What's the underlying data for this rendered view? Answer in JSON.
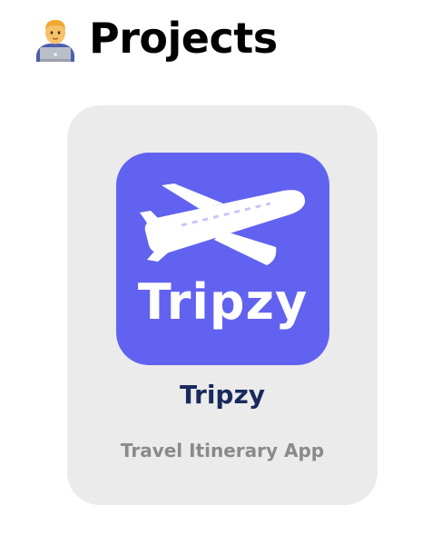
{
  "header": {
    "emoji_icon": "man-technologist-emoji",
    "title": "Projects"
  },
  "projects": [
    {
      "name": "Tripzy",
      "description": "Travel Itinerary App",
      "icon": {
        "name": "airplane-icon",
        "wordmark": "Tripzy",
        "background_color": "#6262f0"
      }
    }
  ],
  "colors": {
    "card_background": "#ebebeb",
    "project_name": "#1a2a5c",
    "project_description": "#8a8a8a"
  }
}
